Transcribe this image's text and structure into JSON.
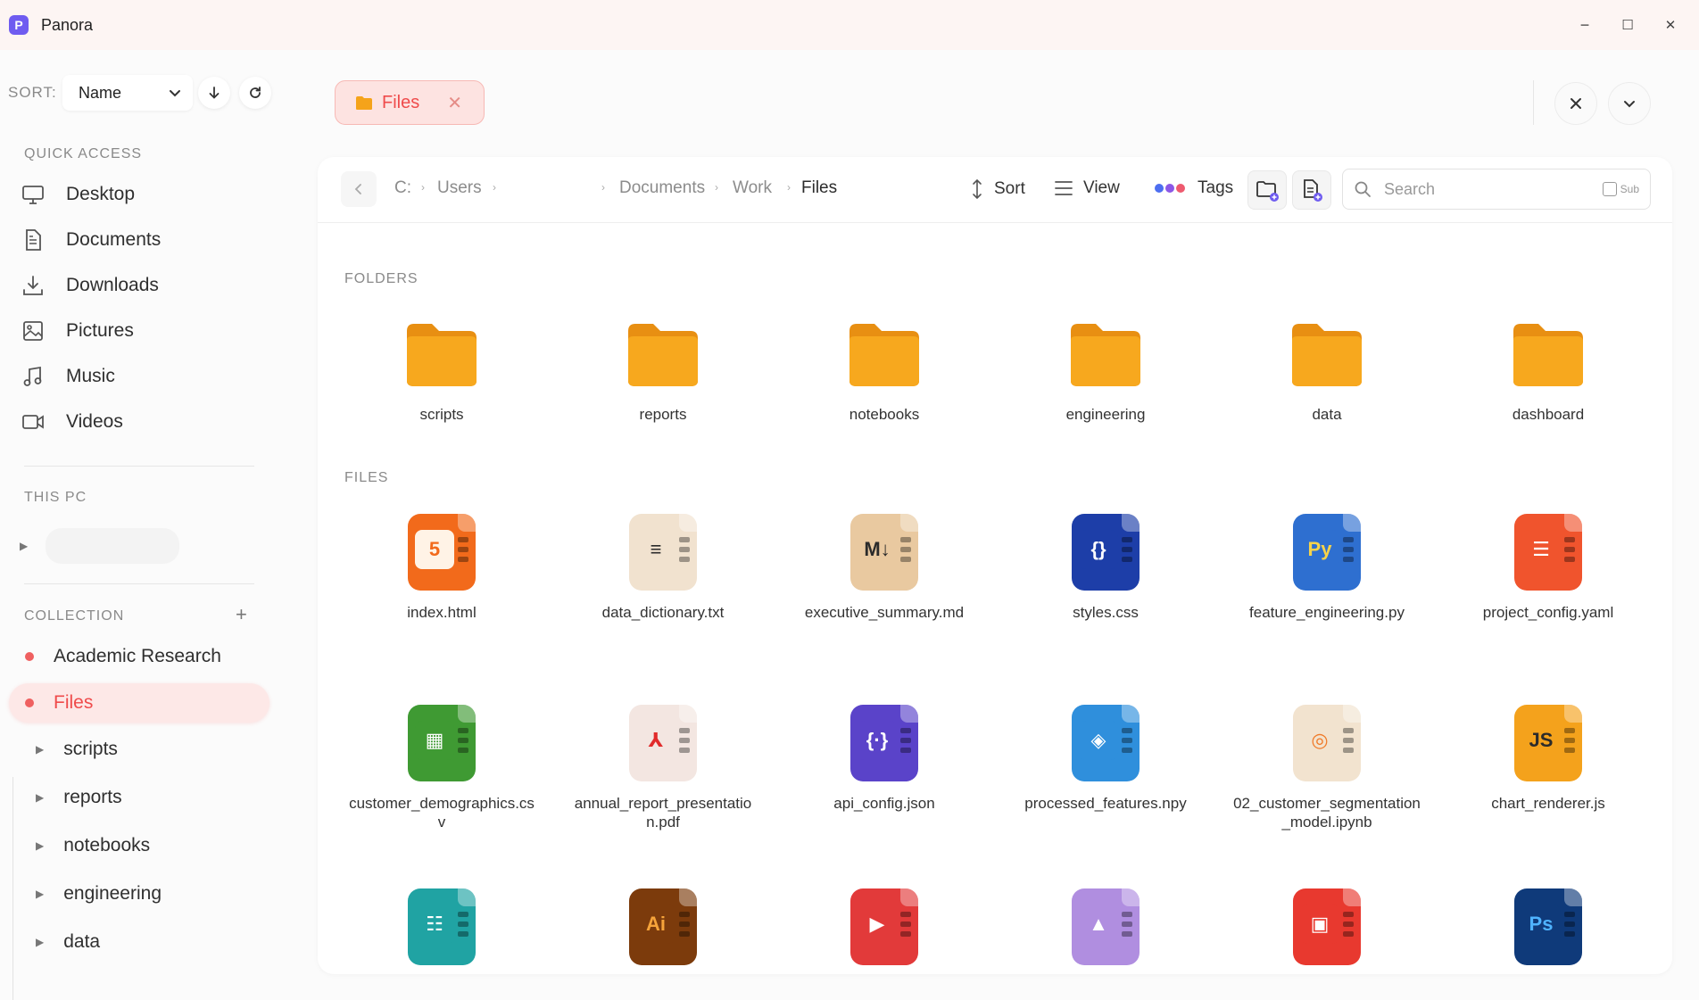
{
  "app": {
    "title": "Panora",
    "logo_letter": "P"
  },
  "window": {
    "minimize": "−",
    "maximize": "☐",
    "close": "✕"
  },
  "sidebar": {
    "sort_label": "SORT:",
    "sort_value": "Name",
    "quick_access_title": "QUICK ACCESS",
    "quick_access": [
      {
        "label": "Desktop",
        "icon": "monitor-icon"
      },
      {
        "label": "Documents",
        "icon": "document-icon"
      },
      {
        "label": "Downloads",
        "icon": "download-icon"
      },
      {
        "label": "Pictures",
        "icon": "image-icon"
      },
      {
        "label": "Music",
        "icon": "music-icon"
      },
      {
        "label": "Videos",
        "icon": "video-icon"
      }
    ],
    "this_pc_title": "THIS PC",
    "collection_title": "COLLECTION",
    "collection_add": "+",
    "collections": [
      {
        "label": "Academic Research",
        "active": false
      },
      {
        "label": "Files",
        "active": true
      }
    ],
    "tree": [
      "scripts",
      "reports",
      "notebooks",
      "engineering",
      "data"
    ]
  },
  "tabs": [
    {
      "label": "Files",
      "close": "✕"
    }
  ],
  "toolbar": {
    "breadcrumb": [
      "C:",
      "Users",
      "Documents",
      "Work",
      "Files"
    ],
    "sort_label": "Sort",
    "view_label": "View",
    "tags_label": "Tags",
    "tag_colors": [
      "#4d6ef0",
      "#8c57e6",
      "#ee5a6f"
    ],
    "search_placeholder": "Search",
    "sub_label": "Sub"
  },
  "content": {
    "folders_title": "FOLDERS",
    "files_title": "FILES",
    "folders": [
      "scripts",
      "reports",
      "notebooks",
      "engineering",
      "data",
      "dashboard"
    ],
    "files": [
      {
        "name": "index.html",
        "color": "#f26a1b",
        "glyph": "5",
        "glyph_bg": "#fff3e6",
        "glyph_color": "#f26a1b"
      },
      {
        "name": "data_dictionary.txt",
        "color": "#f1e2cf",
        "glyph": "≡",
        "glyph_bg": "#f1e2cf",
        "glyph_color": "#2b2b2b"
      },
      {
        "name": "executive_summary.md",
        "color": "#e9c9a0",
        "glyph": "M↓",
        "glyph_bg": "#e9c9a0",
        "glyph_color": "#2b2b2b"
      },
      {
        "name": "styles.css",
        "color": "#1d3ea8",
        "glyph": "{}",
        "glyph_bg": "#1d3ea8",
        "glyph_color": "#ffffff"
      },
      {
        "name": "feature_engineering.py",
        "color": "#2e6fd0",
        "glyph": "Py",
        "glyph_bg": "#2e6fd0",
        "glyph_color": "#f6d34a"
      },
      {
        "name": "project_config.yaml",
        "color": "#f0542d",
        "glyph": "☰",
        "glyph_bg": "#f0542d",
        "glyph_color": "#ffffff"
      },
      {
        "name": "customer_demographics.csv",
        "color": "#3f9a33",
        "glyph": "▦",
        "glyph_bg": "#3f9a33",
        "glyph_color": "#ffffff"
      },
      {
        "name": "annual_report_presentation.pdf",
        "color": "#f3e6e1",
        "glyph": "⅄",
        "glyph_bg": "#f3e6e1",
        "glyph_color": "#e12b2b"
      },
      {
        "name": "api_config.json",
        "color": "#5a43c9",
        "glyph": "{·}",
        "glyph_bg": "#5a43c9",
        "glyph_color": "#ffffff"
      },
      {
        "name": "processed_features.npy",
        "color": "#2f8fdc",
        "glyph": "◈",
        "glyph_bg": "#2f8fdc",
        "glyph_color": "#ffffff"
      },
      {
        "name": "02_customer_segmentation_model.ipynb",
        "color": "#f2e3cf",
        "glyph": "◎",
        "glyph_bg": "#f2e3cf",
        "glyph_color": "#f07b2a"
      },
      {
        "name": "chart_renderer.js",
        "color": "#f4a21c",
        "glyph": "JS",
        "glyph_bg": "#f4a21c",
        "glyph_color": "#2b2b2b"
      },
      {
        "name": "",
        "color": "#20a3a3",
        "glyph": "☷",
        "glyph_bg": "#20a3a3",
        "glyph_color": "#ffffff"
      },
      {
        "name": "",
        "color": "#7c3b0c",
        "glyph": "Ai",
        "glyph_bg": "#7c3b0c",
        "glyph_color": "#f6a43a"
      },
      {
        "name": "",
        "color": "#e23a3a",
        "glyph": "▶",
        "glyph_bg": "#e23a3a",
        "glyph_color": "#ffffff"
      },
      {
        "name": "",
        "color": "#b08ee0",
        "glyph": "▲",
        "glyph_bg": "#b08ee0",
        "glyph_color": "#ffffff"
      },
      {
        "name": "",
        "color": "#e8392f",
        "glyph": "▣",
        "glyph_bg": "#e8392f",
        "glyph_color": "#ffffff"
      },
      {
        "name": "",
        "color": "#0f3a7a",
        "glyph": "Ps",
        "glyph_bg": "#0f3a7a",
        "glyph_color": "#4fb3ff"
      }
    ]
  },
  "colors": {
    "accent": "#ef4b4b",
    "folder": "#f5a31a"
  }
}
